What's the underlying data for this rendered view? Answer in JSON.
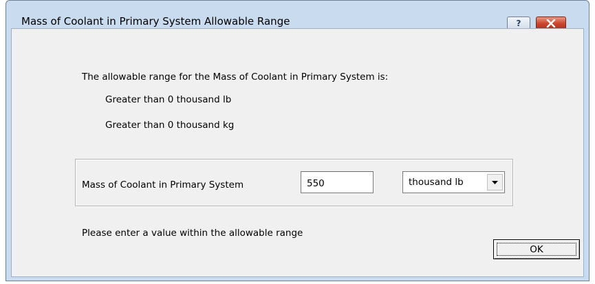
{
  "dialog": {
    "title": "Mass of Coolant in Primary System Allowable Range",
    "help_glyph": "?",
    "close_icon": "close-icon"
  },
  "range_info": {
    "intro": "The allowable range for the Mass of Coolant in Primary System is:",
    "range_lb": "Greater than 0 thousand lb",
    "range_kg": "Greater than 0 thousand kg"
  },
  "input_group": {
    "label": "Mass of Coolant in Primary System",
    "value": "550",
    "unit_selected": "thousand lb"
  },
  "message": "Please enter a value within the allowable range",
  "buttons": {
    "ok_label": "OK"
  },
  "colors": {
    "window_frame": "#c9dbee",
    "client_bg": "#f0f0f0",
    "close_red": "#c9452c"
  }
}
